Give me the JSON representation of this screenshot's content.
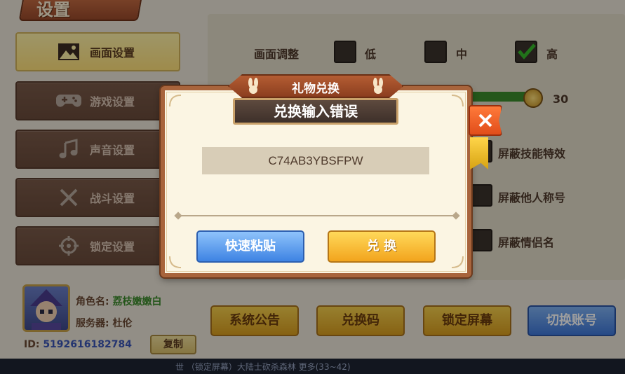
{
  "header": {
    "title": "设置"
  },
  "sidebar": {
    "items": [
      {
        "label": "画面设置",
        "icon": "picture-icon",
        "active": true
      },
      {
        "label": "游戏设置",
        "icon": "gamepad-icon",
        "active": false
      },
      {
        "label": "声音设置",
        "icon": "music-icon",
        "active": false
      },
      {
        "label": "战斗设置",
        "icon": "crossed-swords-icon",
        "active": false
      },
      {
        "label": "锁定设置",
        "icon": "crosshair-icon",
        "active": false
      }
    ]
  },
  "profile": {
    "name_label": "角色名:",
    "name_value": "荔枝嫩嫩白",
    "server_label": "服务器:",
    "server_value": "杜伦",
    "id_label": "ID:",
    "id_value": "5192616182784",
    "copy_label": "复制"
  },
  "settings": {
    "quality_label": "画面调整",
    "quality_options": [
      {
        "label": "低",
        "checked": false
      },
      {
        "label": "中",
        "checked": false
      },
      {
        "label": "高",
        "checked": true
      }
    ],
    "slider_value": "30",
    "toggles": [
      {
        "label": "屏蔽技能特效"
      },
      {
        "label": "屏蔽他人称号"
      },
      {
        "label": "屏蔽情侣名"
      }
    ]
  },
  "footer": {
    "buttons": [
      {
        "label": "系统公告"
      },
      {
        "label": "兑换码"
      },
      {
        "label": "锁定屏幕"
      },
      {
        "label": "切换账号"
      }
    ],
    "ticker": "世  （锁定屏幕）大陆士砍杀森林  更多(33~42)"
  },
  "dialog": {
    "title": "礼物兑换",
    "error_text": "兑换输入错误",
    "code_value": "C74AB3YBSFPW",
    "paste_label": "快速粘贴",
    "exchange_label": "兑 换"
  },
  "colors": {
    "dialog_border": "#a8643c",
    "active_tab": "#ffe17a",
    "check_green": "#36b82a",
    "blue_button": "#3e83e3",
    "gold_button": "#f2a41d"
  }
}
